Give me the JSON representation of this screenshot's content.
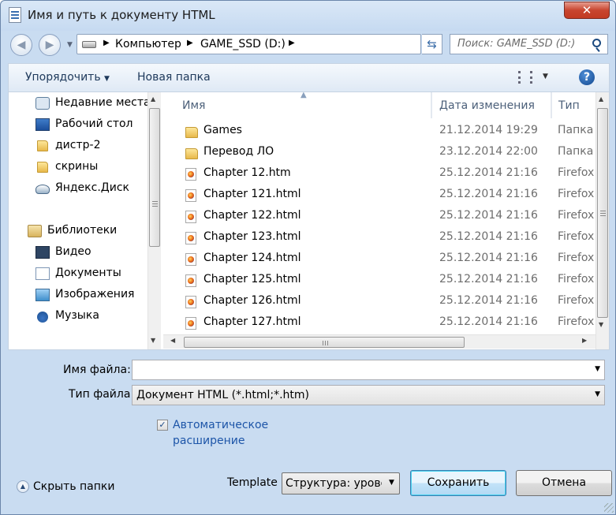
{
  "window": {
    "title": "Имя и путь к документу HTML",
    "close_symbol": "✕"
  },
  "address": {
    "crumbs": [
      "Компьютер",
      "GAME_SSD (D:)"
    ],
    "search_placeholder": "Поиск: GAME_SSD (D:)"
  },
  "toolbar": {
    "organize": "Упорядочить",
    "new_folder": "Новая папка",
    "help": "?"
  },
  "nav": {
    "favorites": [
      {
        "label": "Недавние места",
        "icon": "recent-places-icon"
      },
      {
        "label": "Рабочий стол",
        "icon": "desktop-icon"
      },
      {
        "label": "дистр-2",
        "icon": "folder-icon"
      },
      {
        "label": "скрины",
        "icon": "folder-icon"
      },
      {
        "label": "Яндекс.Диск",
        "icon": "yandex-disk-icon"
      }
    ],
    "libraries_label": "Библиотеки",
    "libraries": [
      {
        "label": "Видео",
        "icon": "video-library-icon"
      },
      {
        "label": "Документы",
        "icon": "documents-library-icon"
      },
      {
        "label": "Изображения",
        "icon": "images-library-icon"
      },
      {
        "label": "Музыка",
        "icon": "music-library-icon"
      }
    ]
  },
  "files": {
    "columns": {
      "name": "Имя",
      "date": "Дата изменения",
      "type": "Тип"
    },
    "rows": [
      {
        "name": "Games",
        "date": "21.12.2014 19:29",
        "type": "Папка",
        "kind": "folder"
      },
      {
        "name": "Перевод ЛО",
        "date": "23.12.2014 22:00",
        "type": "Папка",
        "kind": "folder"
      },
      {
        "name": "Chapter 12.htm",
        "date": "25.12.2014 21:16",
        "type": "Firefox",
        "kind": "firefox"
      },
      {
        "name": "Chapter 121.html",
        "date": "25.12.2014 21:16",
        "type": "Firefox",
        "kind": "firefox"
      },
      {
        "name": "Chapter 122.html",
        "date": "25.12.2014 21:16",
        "type": "Firefox",
        "kind": "firefox"
      },
      {
        "name": "Chapter 123.html",
        "date": "25.12.2014 21:16",
        "type": "Firefox",
        "kind": "firefox"
      },
      {
        "name": "Chapter 124.html",
        "date": "25.12.2014 21:16",
        "type": "Firefox",
        "kind": "firefox"
      },
      {
        "name": "Chapter 125.html",
        "date": "25.12.2014 21:16",
        "type": "Firefox",
        "kind": "firefox"
      },
      {
        "name": "Chapter 126.html",
        "date": "25.12.2014 21:16",
        "type": "Firefox",
        "kind": "firefox"
      },
      {
        "name": "Chapter 127.html",
        "date": "25.12.2014 21:16",
        "type": "Firefox",
        "kind": "firefox"
      }
    ]
  },
  "form": {
    "filename_label": "Имя файла:",
    "filename_value": "",
    "filetype_label": "Тип файла:",
    "filetype_value": "Документ HTML (*.html;*.htm)",
    "auto_ext_line1": "Автоматическое",
    "auto_ext_line2": "расширение",
    "auto_ext_checked": true,
    "hide_folders": "Скрыть папки",
    "template_label": "Template",
    "template_value": "Структура: уровень",
    "save": "Сохранить",
    "cancel": "Отмена"
  }
}
